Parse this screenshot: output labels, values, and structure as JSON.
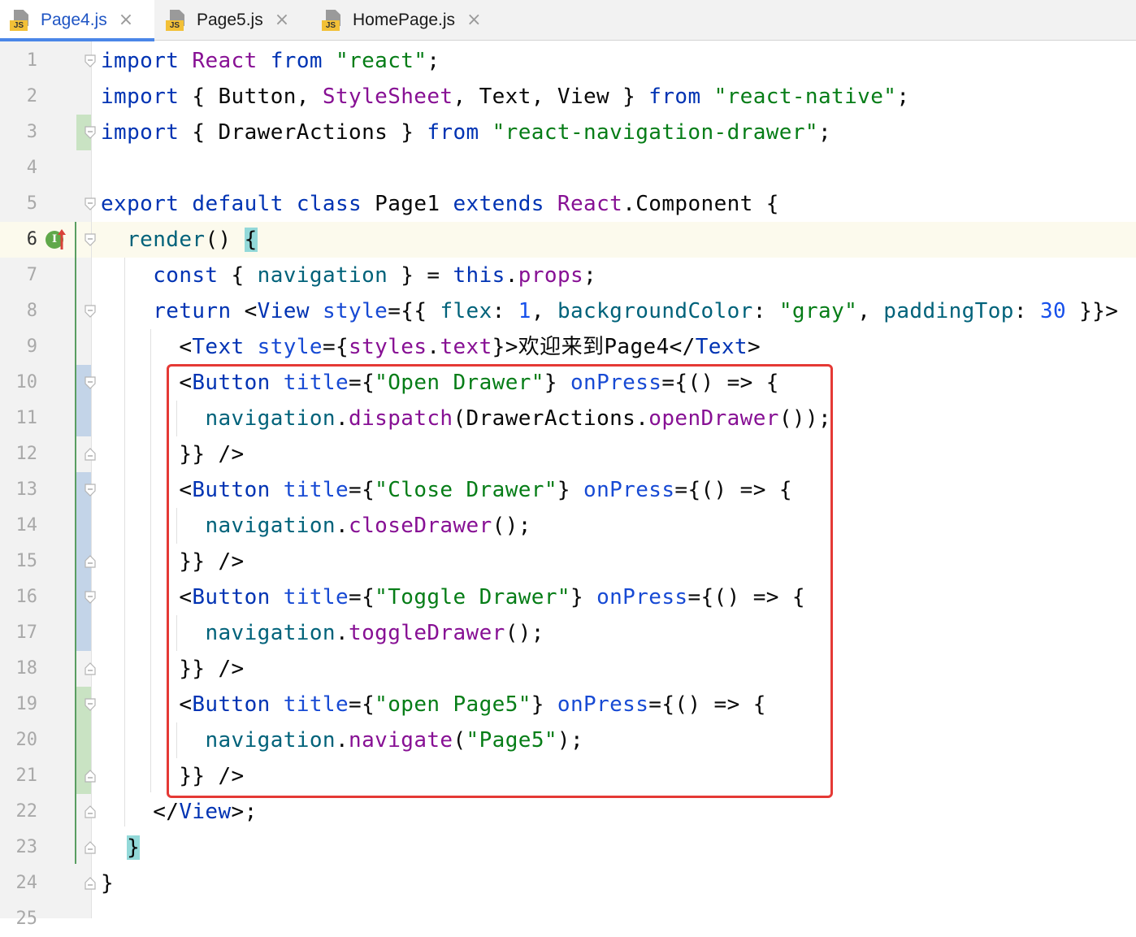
{
  "tabs": [
    {
      "label": "Page4.js",
      "active": true,
      "icon": "js-file-icon"
    },
    {
      "label": "Page5.js",
      "active": false,
      "icon": "js-file-icon"
    },
    {
      "label": "HomePage.js",
      "active": false,
      "icon": "js-file-icon"
    }
  ],
  "js_badge": "JS",
  "close_glyph": "×",
  "current_line": 6,
  "line_numbers": [
    "1",
    "2",
    "3",
    "4",
    "5",
    "6",
    "7",
    "8",
    "9",
    "10",
    "11",
    "12",
    "13",
    "14",
    "15",
    "16",
    "17",
    "18",
    "19",
    "20",
    "21",
    "22",
    "23",
    "24",
    "25"
  ],
  "code_lines": [
    "import React from \"react\";",
    "import { Button, StyleSheet, Text, View } from \"react-native\";",
    "import { DrawerActions } from \"react-navigation-drawer\";",
    "",
    "export default class Page1 extends React.Component {",
    "  render() {",
    "    const { navigation } = this.props;",
    "    return <View style={{ flex: 1, backgroundColor: \"gray\", paddingTop: 30 }}>",
    "      <Text style={styles.text}>欢迎来到Page4</Text>",
    "      <Button title={\"Open Drawer\"} onPress={() => {",
    "        navigation.dispatch(DrawerActions.openDrawer());",
    "      }} />",
    "      <Button title={\"Close Drawer\"} onPress={() => {",
    "        navigation.closeDrawer();",
    "      }} />",
    "      <Button title={\"Toggle Drawer\"} onPress={() => {",
    "        navigation.toggleDrawer();",
    "      }} />",
    "      <Button title={\"open Page5\"} onPress={() => {",
    "        navigation.navigate(\"Page5\");",
    "      }} />",
    "    </View>;",
    "  }",
    "}"
  ],
  "gutter_icons": {
    "implements": "I"
  },
  "colors": {
    "keyword": "#0033b3",
    "string": "#067d17",
    "member": "#871094",
    "highlight_box": "#e53935",
    "current_line": "#fcfaed"
  }
}
